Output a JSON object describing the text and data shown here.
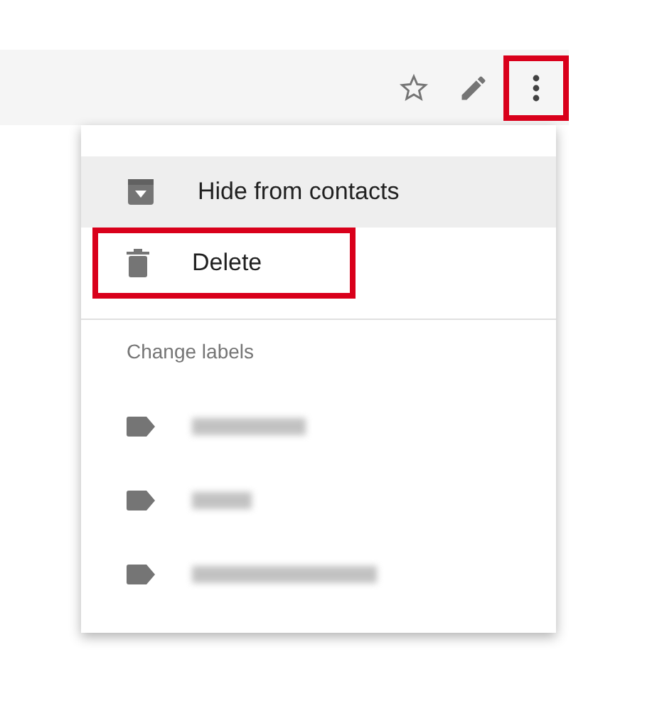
{
  "toolbar": {
    "actions": [
      {
        "kind": "star",
        "highlighted": false
      },
      {
        "kind": "edit",
        "highlighted": false
      },
      {
        "kind": "more",
        "highlighted": true
      }
    ]
  },
  "menu": {
    "items": [
      {
        "kind": "hide",
        "label": "Hide from contacts",
        "selected": true,
        "highlighted": false
      },
      {
        "kind": "delete",
        "label": "Delete",
        "selected": false,
        "highlighted": true
      }
    ],
    "section_title": "Change labels",
    "labels": [
      {
        "blurred": true
      },
      {
        "blurred": true
      },
      {
        "blurred": true
      }
    ]
  }
}
